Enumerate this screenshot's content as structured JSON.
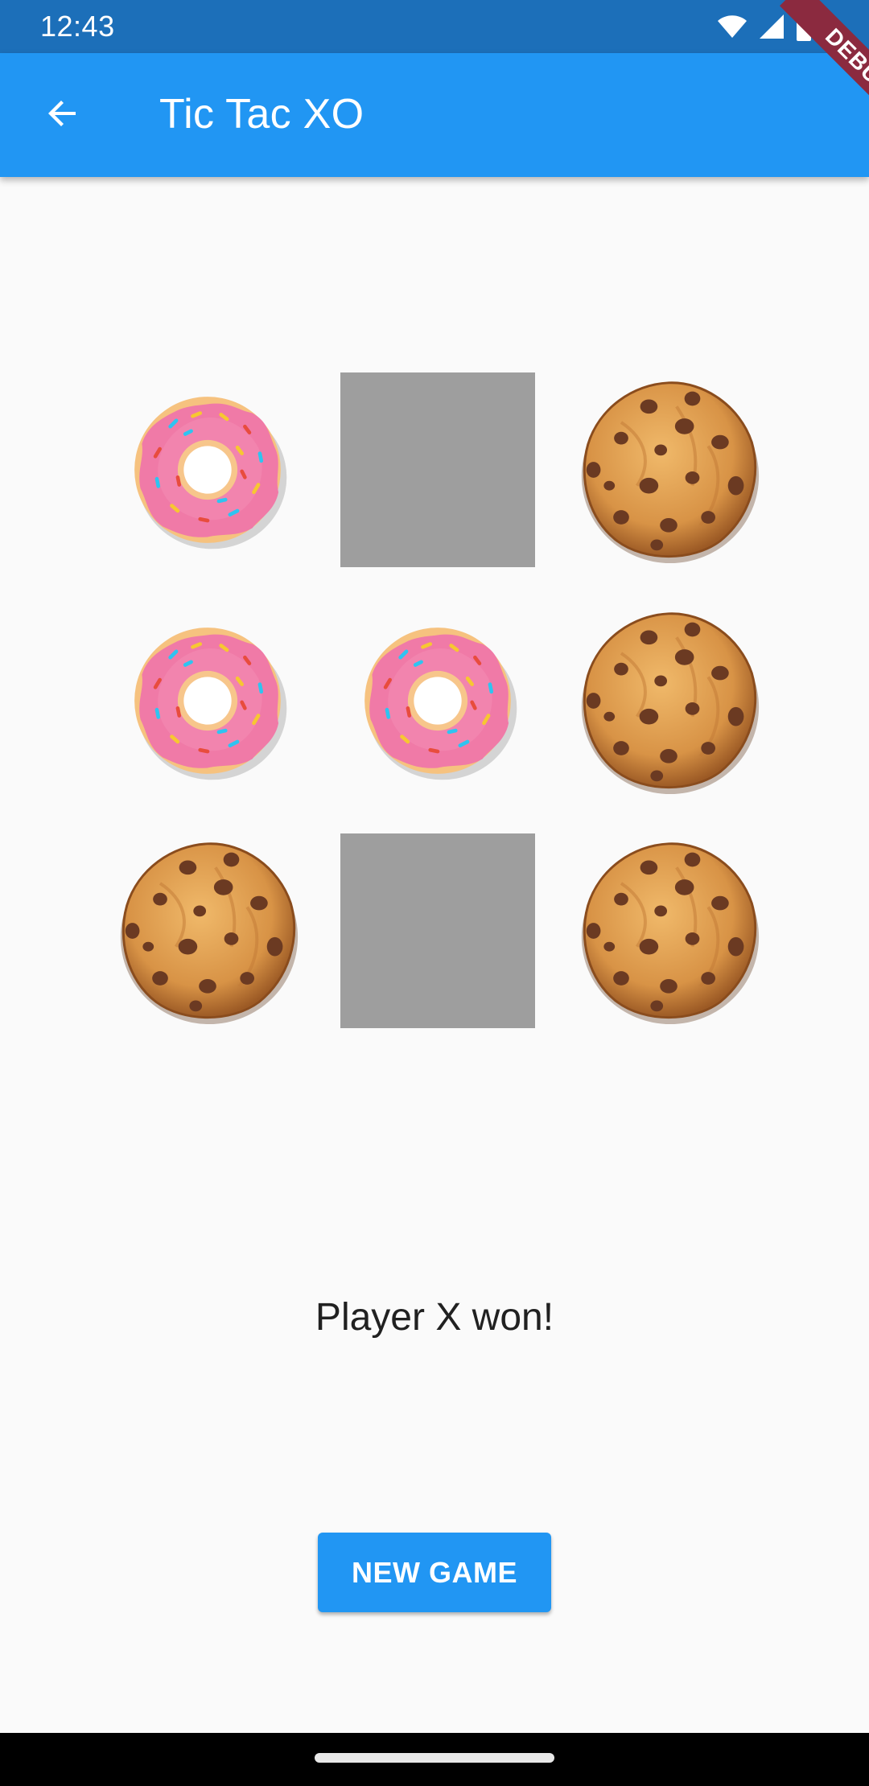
{
  "status_bar": {
    "time": "12:43",
    "icons": [
      "wifi-icon",
      "signal-icon",
      "battery-icon"
    ]
  },
  "app_bar": {
    "title": "Tic Tac XO",
    "back_icon": "arrow-back-icon"
  },
  "debug_banner": {
    "label": "DEBUG"
  },
  "board": {
    "cells": [
      [
        "donut",
        "empty",
        "cookie"
      ],
      [
        "donut",
        "donut",
        "cookie"
      ],
      [
        "cookie",
        "empty",
        "cookie"
      ]
    ]
  },
  "status_message": "Player X won!",
  "new_game_button": {
    "label": "NEW GAME"
  },
  "colors": {
    "primary": "#2196f3",
    "status_bar": "#1c6fb9",
    "empty_tile": "#9e9e9e",
    "debug": "#8b2a3f"
  }
}
